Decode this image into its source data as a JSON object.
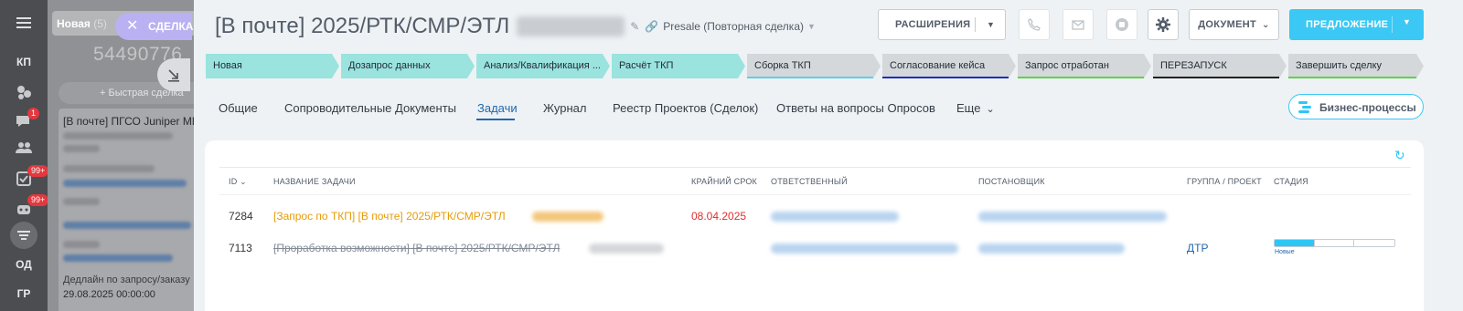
{
  "rail": {
    "items": [
      {
        "label": "КП"
      },
      {
        "label": "ОД"
      },
      {
        "label": "ГР"
      }
    ],
    "badges": [
      "1",
      "99+",
      "99+"
    ]
  },
  "kanban": {
    "column_name": "Новая",
    "column_count": "(5)",
    "deal_count": "54490776",
    "quick_deal": "Быстрая сделка",
    "card_title": "[В почте] ПГСО Juniper MM",
    "deadline_label": "Дедлайн по запросу/заказу",
    "deadline_value": "29.08.2025 00:00:00"
  },
  "deal_tag": "СДЕЛКА",
  "header": {
    "title": "[В почте] 2025/РТК/СМР/ЭТЛ",
    "pipeline": "Presale (Повторная сделка)",
    "extensions_label": "РАСШИРЕНИЯ",
    "document_label": "ДОКУМЕНТ",
    "proposal_label": "ПРЕДЛОЖЕНИЕ"
  },
  "stages": [
    {
      "label": "Новая",
      "state": "done",
      "color": "#9ae3de"
    },
    {
      "label": "Дозапрос данных",
      "state": "done",
      "color": "#9ae3de"
    },
    {
      "label": "Анализ/Квалификация ...",
      "state": "done",
      "color": "#9ae3de"
    },
    {
      "label": "Расчёт ТКП",
      "state": "done",
      "color": "#9ae3de"
    },
    {
      "label": "Сборка ТКП",
      "state": "todo",
      "color": "#5fd0e8"
    },
    {
      "label": "Согласование кейса",
      "state": "todo",
      "color": "#1a2fbf"
    },
    {
      "label": "Запрос отработан",
      "state": "todo",
      "color": "#5cd44a"
    },
    {
      "label": "ПЕРЕЗАПУСК",
      "state": "todo",
      "color": "#222222"
    },
    {
      "label": "Завершить сделку",
      "state": "todo",
      "color": "#5cd44a"
    }
  ],
  "tabs": [
    {
      "label": "Общие"
    },
    {
      "label": "Сопроводительные Документы"
    },
    {
      "label": "Задачи",
      "active": true
    },
    {
      "label": "Журнал"
    },
    {
      "label": "Реестр Проектов (Сделок)"
    },
    {
      "label": "Ответы на вопросы Опросов"
    },
    {
      "label": "Еще"
    }
  ],
  "business_processes_label": "Бизнес-процессы",
  "tasks": {
    "columns": {
      "id": "ID",
      "name": "НАЗВАНИЕ ЗАДАЧИ",
      "deadline": "КРАЙНИЙ СРОК",
      "responsible": "ОТВЕТСТВЕННЫЙ",
      "creator": "ПОСТАНОВЩИК",
      "group": "ГРУППА / ПРОЕКТ",
      "stage": "СТАДИЯ"
    },
    "rows": [
      {
        "id": "7284",
        "name": "[Запрос по ТКП] [В почте] 2025/РТК/СМР/ЭТЛ",
        "deadline": "08.04.2025",
        "group": "",
        "stage": ""
      },
      {
        "id": "7113",
        "name": "[Проработка возможности] [В почте] 2025/РТК/СМР/ЭТЛ",
        "deadline": "",
        "group": "ДТР",
        "stage": "Новые",
        "progress": 0.33
      }
    ]
  }
}
